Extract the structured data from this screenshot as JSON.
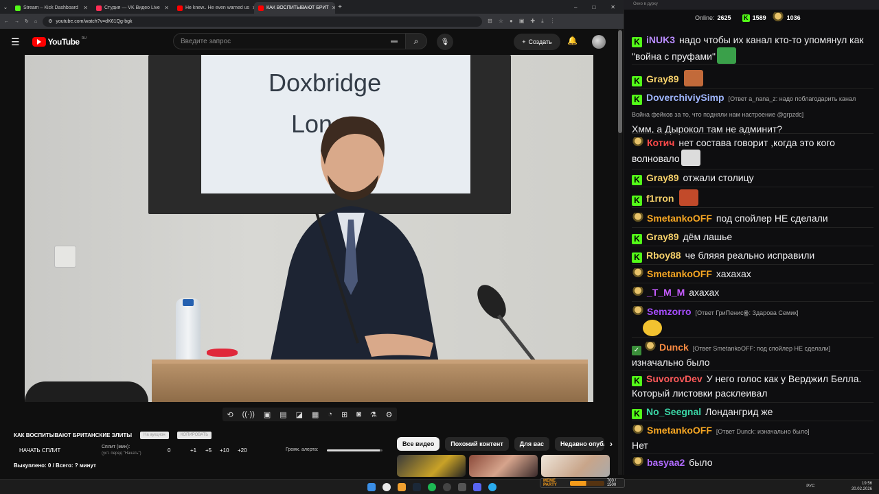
{
  "browser": {
    "tabs": [
      {
        "label": "Stream – Kick Dashboard",
        "color": "#53fc18"
      },
      {
        "label": "Студия — VK Видео Live",
        "color": "#ff2d55"
      },
      {
        "label": "He knew.. He even warned us",
        "color": "#ff0000"
      },
      {
        "label": "КАК ВОСПИТЫВАЮТ БРИТ",
        "color": "#ff0000",
        "active": true
      }
    ],
    "url": "youtube.com/watch?v=dK61Qg-bgk"
  },
  "youtube": {
    "logo_text": "YouTube",
    "region": "RU",
    "search_placeholder": "Введите запрос",
    "create_label": "Создать"
  },
  "video": {
    "slide_line1": "Doxbridge",
    "slide_line2": "Lon"
  },
  "panel": {
    "title": "КАК ВОСПИТЫВАЮТ БРИТАНСКИЕ ЭЛИТЫ",
    "chip1": "На аукцион",
    "chip2": "КОПИРОВАТЬ",
    "start_split": "НАЧАТЬ СПЛИТ",
    "split_label": "Сплит (мин):",
    "split_hint": "(уст. перед \"Начать\")",
    "split_values": [
      "0",
      "+1",
      "+5",
      "+10",
      "+20"
    ],
    "alert_volume_label": "Громк. алерта:",
    "alert_volume": 0.95,
    "bought": "Выкуплено: 0 / Всего: ? минут"
  },
  "filters": [
    "Все видео",
    "Похожий контент",
    "Для вас",
    "Недавно опубл"
  ],
  "chat": {
    "window_title": "Окно в дурку",
    "online_label": "Online:",
    "online": "2625",
    "kick_count": "1589",
    "vk_count": "1036",
    "messages": [
      {
        "badge": "K",
        "nick": "iNUK3",
        "color": "#b98cff",
        "text": "надо чтобы их канал кто-то упомянул как \"война с пруфами\"",
        "emote": "#3aa04a"
      },
      {
        "badge": "K",
        "nick": "Gray89",
        "color": "#f5d06a",
        "text": "",
        "emote": "#c26a3a"
      },
      {
        "badge": "K",
        "nick": "DoverchiviySimp",
        "color": "#9fb6ff",
        "reply": "[Ответ a_nana_z: надо поблагодарить канал Война фейков за то, что подняли нам настроение @grpzdc]",
        "text": "Хмм, а Дырокол там не админит?"
      },
      {
        "badge": "P",
        "nick": "Котич",
        "color": "#ff4a4a",
        "text": "нет состава говорит ,когда это кого волновало",
        "emote": "#dcdcdc"
      },
      {
        "badge": "K",
        "nick": "Gray89",
        "color": "#f5d06a",
        "text": "отжали столицу"
      },
      {
        "badge": "K",
        "nick": "f1rron",
        "color": "#f5d06a",
        "text": "",
        "emote": "#c24a2a"
      },
      {
        "badge": "P",
        "nick": "SmetankoOFF",
        "color": "#f5a623",
        "text": "под спойлер НЕ сделали"
      },
      {
        "badge": "K",
        "nick": "Gray89",
        "color": "#f5d06a",
        "text": "дём лашье"
      },
      {
        "badge": "K",
        "nick": "Rboy88",
        "color": "#f5d06a",
        "text": "че бляяя реально исправили"
      },
      {
        "badge": "P",
        "nick": "SmetankoOFF",
        "color": "#f5a623",
        "text": "хахахах"
      },
      {
        "badge": "P",
        "nick": "_T_M_M",
        "color": "#c65cff",
        "text": "ахахах"
      },
      {
        "badge": "P",
        "nick": "Semzorro",
        "color": "#a64dff",
        "reply": "[Ответ ГриПенисꙮ: Здарова Семик]",
        "text": "",
        "emote": "#f2c230"
      },
      {
        "badge": "CP",
        "nick": "Dunck",
        "color": "#ff8c42",
        "reply": "[Ответ SmetankoOFF: под спойлер НЕ сделали]",
        "text": "изначально было"
      },
      {
        "badge": "K",
        "nick": "SuvorovDev",
        "color": "#ff5a5a",
        "text": "У него голос как у Верджил Белла. Который листовки расклеивал"
      },
      {
        "badge": "K",
        "nick": "No_Seegnal",
        "color": "#3ad6a6",
        "text": "Лондангрид же"
      },
      {
        "badge": "P",
        "nick": "SmetankoOFF",
        "color": "#f5a623",
        "reply": "[Ответ Dunck: изначально было]",
        "text": "Нет"
      },
      {
        "badge": "P",
        "nick": "basyaa2",
        "color": "#b06bff",
        "text": "было"
      }
    ]
  },
  "taskbar": {
    "meme_label": "MEME PARTY",
    "meme_progress_text": "700 / 1500",
    "meme_progress": 0.47,
    "lang": "РУС",
    "time": "19:56",
    "date": "20.02.2026"
  }
}
